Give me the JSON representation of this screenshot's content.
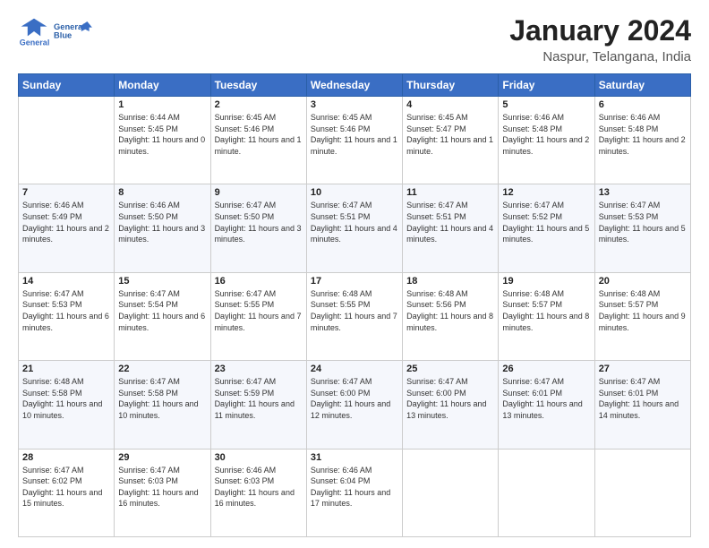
{
  "header": {
    "logo_line1": "General",
    "logo_line2": "Blue",
    "month_title": "January 2024",
    "location": "Naspur, Telangana, India"
  },
  "days_of_week": [
    "Sunday",
    "Monday",
    "Tuesday",
    "Wednesday",
    "Thursday",
    "Friday",
    "Saturday"
  ],
  "weeks": [
    [
      {
        "num": "",
        "sunrise": "",
        "sunset": "",
        "daylight": ""
      },
      {
        "num": "1",
        "sunrise": "Sunrise: 6:44 AM",
        "sunset": "Sunset: 5:45 PM",
        "daylight": "Daylight: 11 hours and 0 minutes."
      },
      {
        "num": "2",
        "sunrise": "Sunrise: 6:45 AM",
        "sunset": "Sunset: 5:46 PM",
        "daylight": "Daylight: 11 hours and 1 minute."
      },
      {
        "num": "3",
        "sunrise": "Sunrise: 6:45 AM",
        "sunset": "Sunset: 5:46 PM",
        "daylight": "Daylight: 11 hours and 1 minute."
      },
      {
        "num": "4",
        "sunrise": "Sunrise: 6:45 AM",
        "sunset": "Sunset: 5:47 PM",
        "daylight": "Daylight: 11 hours and 1 minute."
      },
      {
        "num": "5",
        "sunrise": "Sunrise: 6:46 AM",
        "sunset": "Sunset: 5:48 PM",
        "daylight": "Daylight: 11 hours and 2 minutes."
      },
      {
        "num": "6",
        "sunrise": "Sunrise: 6:46 AM",
        "sunset": "Sunset: 5:48 PM",
        "daylight": "Daylight: 11 hours and 2 minutes."
      }
    ],
    [
      {
        "num": "7",
        "sunrise": "Sunrise: 6:46 AM",
        "sunset": "Sunset: 5:49 PM",
        "daylight": "Daylight: 11 hours and 2 minutes."
      },
      {
        "num": "8",
        "sunrise": "Sunrise: 6:46 AM",
        "sunset": "Sunset: 5:50 PM",
        "daylight": "Daylight: 11 hours and 3 minutes."
      },
      {
        "num": "9",
        "sunrise": "Sunrise: 6:47 AM",
        "sunset": "Sunset: 5:50 PM",
        "daylight": "Daylight: 11 hours and 3 minutes."
      },
      {
        "num": "10",
        "sunrise": "Sunrise: 6:47 AM",
        "sunset": "Sunset: 5:51 PM",
        "daylight": "Daylight: 11 hours and 4 minutes."
      },
      {
        "num": "11",
        "sunrise": "Sunrise: 6:47 AM",
        "sunset": "Sunset: 5:51 PM",
        "daylight": "Daylight: 11 hours and 4 minutes."
      },
      {
        "num": "12",
        "sunrise": "Sunrise: 6:47 AM",
        "sunset": "Sunset: 5:52 PM",
        "daylight": "Daylight: 11 hours and 5 minutes."
      },
      {
        "num": "13",
        "sunrise": "Sunrise: 6:47 AM",
        "sunset": "Sunset: 5:53 PM",
        "daylight": "Daylight: 11 hours and 5 minutes."
      }
    ],
    [
      {
        "num": "14",
        "sunrise": "Sunrise: 6:47 AM",
        "sunset": "Sunset: 5:53 PM",
        "daylight": "Daylight: 11 hours and 6 minutes."
      },
      {
        "num": "15",
        "sunrise": "Sunrise: 6:47 AM",
        "sunset": "Sunset: 5:54 PM",
        "daylight": "Daylight: 11 hours and 6 minutes."
      },
      {
        "num": "16",
        "sunrise": "Sunrise: 6:47 AM",
        "sunset": "Sunset: 5:55 PM",
        "daylight": "Daylight: 11 hours and 7 minutes."
      },
      {
        "num": "17",
        "sunrise": "Sunrise: 6:48 AM",
        "sunset": "Sunset: 5:55 PM",
        "daylight": "Daylight: 11 hours and 7 minutes."
      },
      {
        "num": "18",
        "sunrise": "Sunrise: 6:48 AM",
        "sunset": "Sunset: 5:56 PM",
        "daylight": "Daylight: 11 hours and 8 minutes."
      },
      {
        "num": "19",
        "sunrise": "Sunrise: 6:48 AM",
        "sunset": "Sunset: 5:57 PM",
        "daylight": "Daylight: 11 hours and 8 minutes."
      },
      {
        "num": "20",
        "sunrise": "Sunrise: 6:48 AM",
        "sunset": "Sunset: 5:57 PM",
        "daylight": "Daylight: 11 hours and 9 minutes."
      }
    ],
    [
      {
        "num": "21",
        "sunrise": "Sunrise: 6:48 AM",
        "sunset": "Sunset: 5:58 PM",
        "daylight": "Daylight: 11 hours and 10 minutes."
      },
      {
        "num": "22",
        "sunrise": "Sunrise: 6:47 AM",
        "sunset": "Sunset: 5:58 PM",
        "daylight": "Daylight: 11 hours and 10 minutes."
      },
      {
        "num": "23",
        "sunrise": "Sunrise: 6:47 AM",
        "sunset": "Sunset: 5:59 PM",
        "daylight": "Daylight: 11 hours and 11 minutes."
      },
      {
        "num": "24",
        "sunrise": "Sunrise: 6:47 AM",
        "sunset": "Sunset: 6:00 PM",
        "daylight": "Daylight: 11 hours and 12 minutes."
      },
      {
        "num": "25",
        "sunrise": "Sunrise: 6:47 AM",
        "sunset": "Sunset: 6:00 PM",
        "daylight": "Daylight: 11 hours and 13 minutes."
      },
      {
        "num": "26",
        "sunrise": "Sunrise: 6:47 AM",
        "sunset": "Sunset: 6:01 PM",
        "daylight": "Daylight: 11 hours and 13 minutes."
      },
      {
        "num": "27",
        "sunrise": "Sunrise: 6:47 AM",
        "sunset": "Sunset: 6:01 PM",
        "daylight": "Daylight: 11 hours and 14 minutes."
      }
    ],
    [
      {
        "num": "28",
        "sunrise": "Sunrise: 6:47 AM",
        "sunset": "Sunset: 6:02 PM",
        "daylight": "Daylight: 11 hours and 15 minutes."
      },
      {
        "num": "29",
        "sunrise": "Sunrise: 6:47 AM",
        "sunset": "Sunset: 6:03 PM",
        "daylight": "Daylight: 11 hours and 16 minutes."
      },
      {
        "num": "30",
        "sunrise": "Sunrise: 6:46 AM",
        "sunset": "Sunset: 6:03 PM",
        "daylight": "Daylight: 11 hours and 16 minutes."
      },
      {
        "num": "31",
        "sunrise": "Sunrise: 6:46 AM",
        "sunset": "Sunset: 6:04 PM",
        "daylight": "Daylight: 11 hours and 17 minutes."
      },
      {
        "num": "",
        "sunrise": "",
        "sunset": "",
        "daylight": ""
      },
      {
        "num": "",
        "sunrise": "",
        "sunset": "",
        "daylight": ""
      },
      {
        "num": "",
        "sunrise": "",
        "sunset": "",
        "daylight": ""
      }
    ]
  ]
}
